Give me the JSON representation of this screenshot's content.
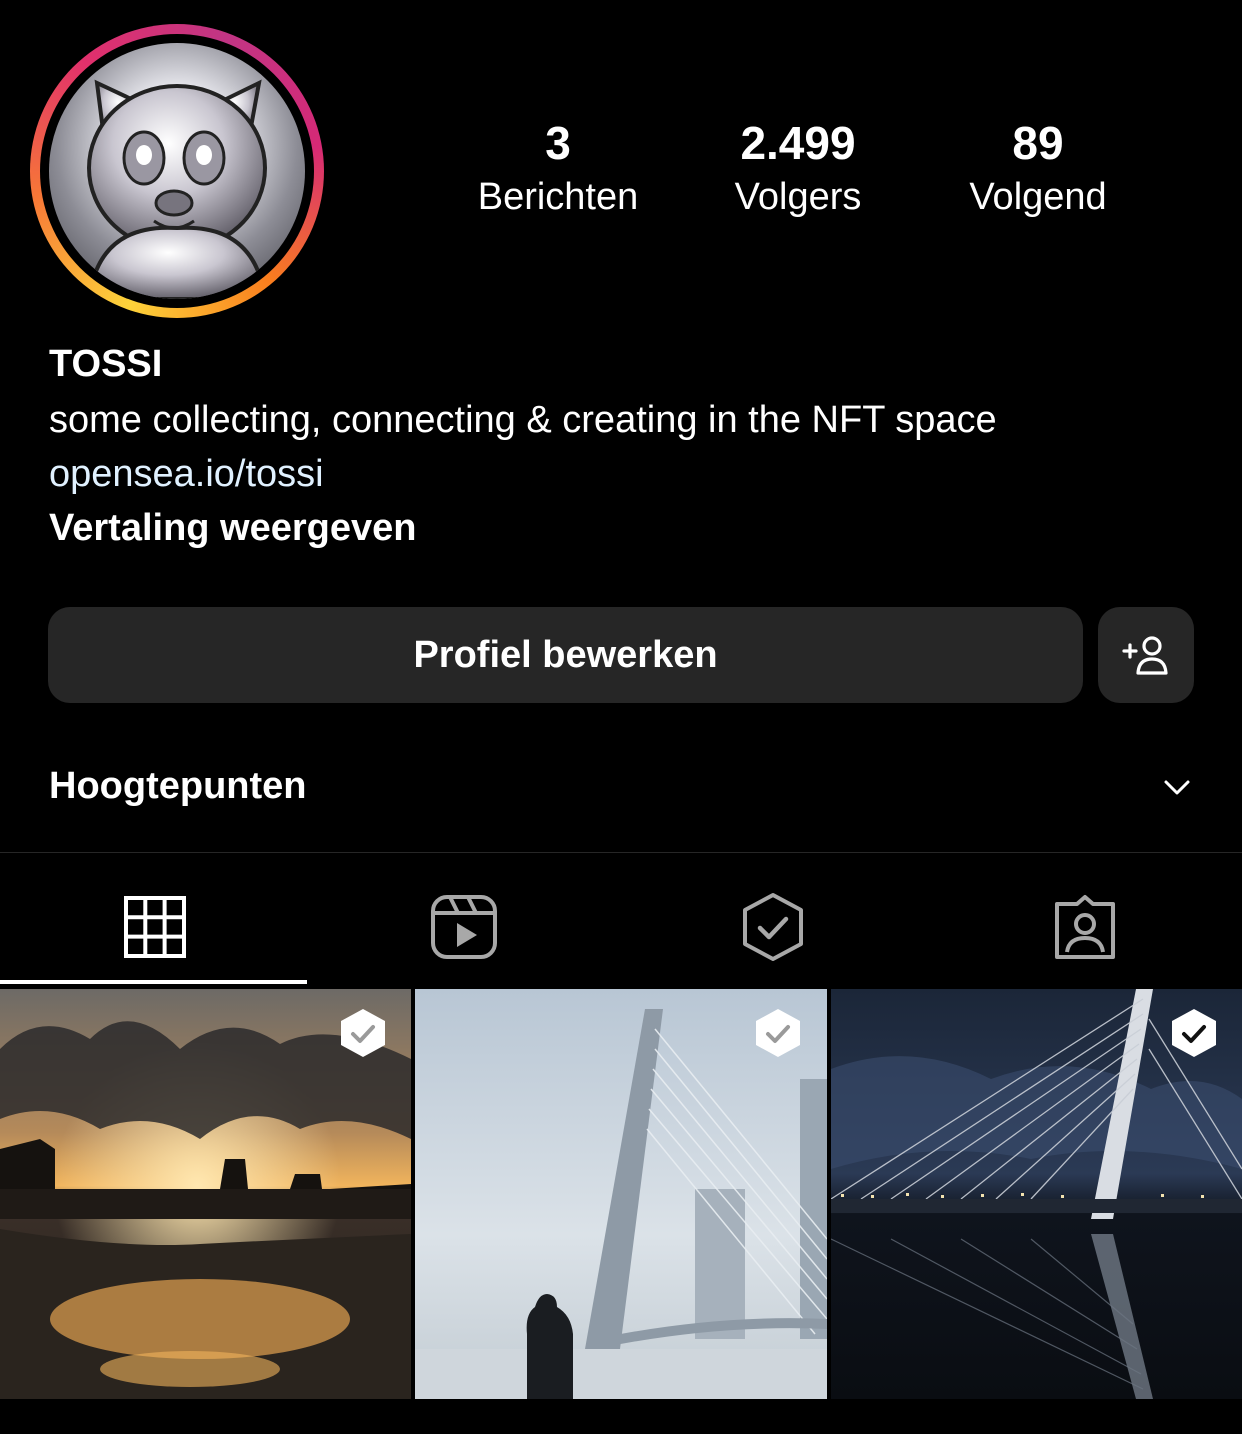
{
  "profile": {
    "name": "TOSSI",
    "bio": "some collecting, connecting & creating in the NFT space",
    "link": "opensea.io/tossi",
    "translate_label": "Vertaling weergeven"
  },
  "stats": {
    "posts": {
      "value": "3",
      "label": "Berichten"
    },
    "followers": {
      "value": "2.499",
      "label": "Volgers"
    },
    "following": {
      "value": "89",
      "label": "Volgend"
    }
  },
  "actions": {
    "edit_profile_label": "Profiel bewerken",
    "add_person_icon": "add-person-icon"
  },
  "highlights": {
    "label": "Hoogtepunten",
    "expand_icon": "chevron-down-icon"
  },
  "tabs": [
    {
      "icon": "grid-icon",
      "active": true
    },
    {
      "icon": "reels-icon",
      "active": false
    },
    {
      "icon": "verified-collectibles-icon",
      "active": false
    },
    {
      "icon": "tagged-icon",
      "active": false
    }
  ],
  "posts": [
    {
      "subject": "sunset-harbor-reflection",
      "badge": "verified-check-icon"
    },
    {
      "subject": "erasmus-bridge-silhouette",
      "badge": "verified-check-icon"
    },
    {
      "subject": "erasmus-bridge-night",
      "badge": "verified-check-icon"
    }
  ],
  "colors": {
    "background": "#000000",
    "button": "#262626",
    "link": "#e0f1ff",
    "ring_start": "#fdd33a",
    "ring_end": "#c13584"
  }
}
